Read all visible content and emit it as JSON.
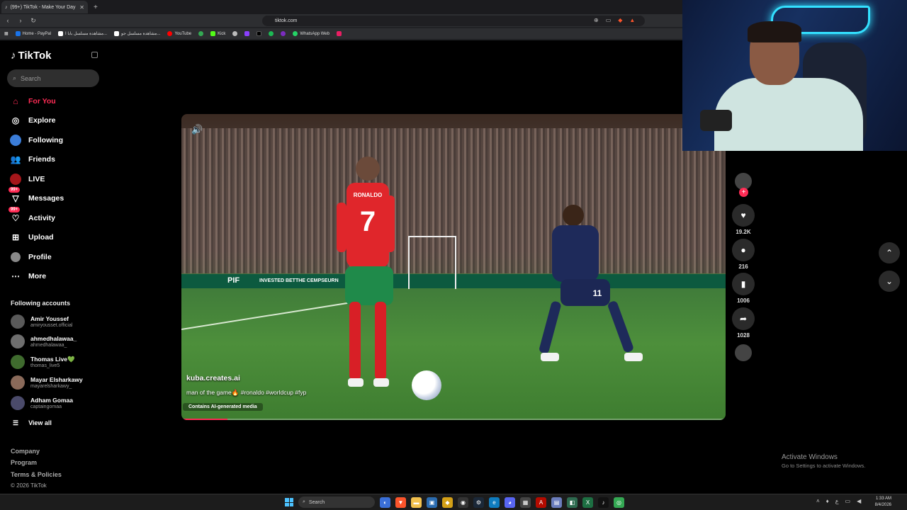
{
  "browser": {
    "tab_title": "(99+) TikTok - Make Your Day",
    "tab_close": "✕",
    "new_tab": "+",
    "url": "tiktok.com",
    "bookmarks": [
      {
        "label": "Home - PayPal",
        "color": "#1a73e8"
      },
      {
        "label": "مشاهدة مسلسل بابا ا...",
        "color": "#ffffff"
      },
      {
        "label": "مشاهدة مسلسل جو...",
        "color": "#ffffff"
      },
      {
        "label": "YouTube",
        "color": "#ff0000"
      },
      {
        "label": "",
        "color": "#34a853"
      },
      {
        "label": "Kick",
        "color": "#53fc18"
      },
      {
        "label": "",
        "color": "#bbbbbb"
      },
      {
        "label": "",
        "color": "#8a3ffc"
      },
      {
        "label": "",
        "color": "#000000"
      },
      {
        "label": "",
        "color": "#1db954"
      },
      {
        "label": "",
        "color": "#7b2cbf"
      },
      {
        "label": "WhatsApp Web",
        "color": "#25d366"
      },
      {
        "label": "",
        "color": "#e91e63"
      }
    ]
  },
  "sidebar": {
    "logo": "TikTok",
    "search_placeholder": "Search",
    "nav": [
      {
        "label": "For You",
        "icon": "home-icon",
        "active": true
      },
      {
        "label": "Explore",
        "icon": "compass-icon"
      },
      {
        "label": "Following",
        "icon": "following-icon"
      },
      {
        "label": "Friends",
        "icon": "friends-icon"
      },
      {
        "label": "LIVE",
        "icon": "live-icon"
      },
      {
        "label": "Messages",
        "icon": "messages-icon",
        "badge": "99+"
      },
      {
        "label": "Activity",
        "icon": "activity-icon",
        "badge": "99+"
      },
      {
        "label": "Upload",
        "icon": "upload-icon"
      },
      {
        "label": "Profile",
        "icon": "profile-icon"
      },
      {
        "label": "More",
        "icon": "more-icon"
      }
    ],
    "following_title": "Following accounts",
    "accounts": [
      {
        "name": "Amir Youssef",
        "handle": "amiryousset.official"
      },
      {
        "name": "ahmedhalawaa_",
        "handle": "ahmedhalawaa_"
      },
      {
        "name": "Thomas Live💚",
        "handle": "thomas_live5"
      },
      {
        "name": "Mayar Elsharkawy",
        "handle": "mayarelsharkawy_"
      },
      {
        "name": "Adham Gomaa",
        "handle": "captaingomaa"
      }
    ],
    "view_all": "View all",
    "footer": [
      "Company",
      "Program",
      "Terms & Policies"
    ],
    "copyright": "© 2026 TikTok"
  },
  "video": {
    "author": "kuba.creates.ai",
    "caption": "man of the game🔥 #ronaldo #worldcup #fyp",
    "ai_label": "Contains AI-generated media",
    "progress": 0.085,
    "jersey_number": "7",
    "jersey_name": "RONALDO",
    "opponent_number": "11",
    "ad_text": "PIF",
    "ad_text_2": "INVESTED BETTHE CEMPSEURN"
  },
  "actions": {
    "likes": "19.2K",
    "comments": "216",
    "saves": "1006",
    "shares": "1028"
  },
  "windows": {
    "activate_title": "Activate Windows",
    "activate_sub": "Go to Settings to activate Windows.",
    "search_label": "Search",
    "time": "1:33 AM",
    "date": "8/4/2026"
  }
}
